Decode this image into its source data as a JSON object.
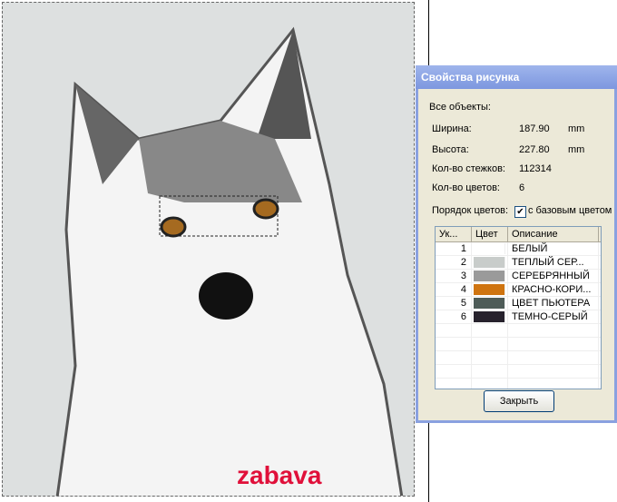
{
  "canvas": {
    "watermark": "zabava"
  },
  "dialog": {
    "title": "Свойства рисунка",
    "all_objects": "Все объекты:",
    "width_label": "Ширина:",
    "width_value": "187.90",
    "width_unit": "mm",
    "height_label": "Высота:",
    "height_value": "227.80",
    "height_unit": "mm",
    "stitches_label": "Кол-во стежков:",
    "stitches_value": "112314",
    "colors_label": "Кол-во цветов:",
    "colors_value": "6",
    "order_label": "Порядок цветов:",
    "order_checked": true,
    "order_option": "с базовым цветом",
    "columns": [
      "Ук...",
      "Цвет",
      "Описание"
    ],
    "rows": [
      {
        "n": "1",
        "color": "#ffffff",
        "desc": "БЕЛЫЙ"
      },
      {
        "n": "2",
        "color": "#c8ccca",
        "desc": "ТЕПЛЫЙ СЕР..."
      },
      {
        "n": "3",
        "color": "#9a9a9a",
        "desc": "СЕРЕБРЯННЫЙ"
      },
      {
        "n": "4",
        "color": "#cf7410",
        "desc": "КРАСНО-КОРИ..."
      },
      {
        "n": "5",
        "color": "#4e5c58",
        "desc": "ЦВЕТ ПЬЮТЕРА"
      },
      {
        "n": "6",
        "color": "#27222d",
        "desc": "ТЕМНО-СЕРЫЙ"
      }
    ],
    "close_label": "Закрыть"
  }
}
